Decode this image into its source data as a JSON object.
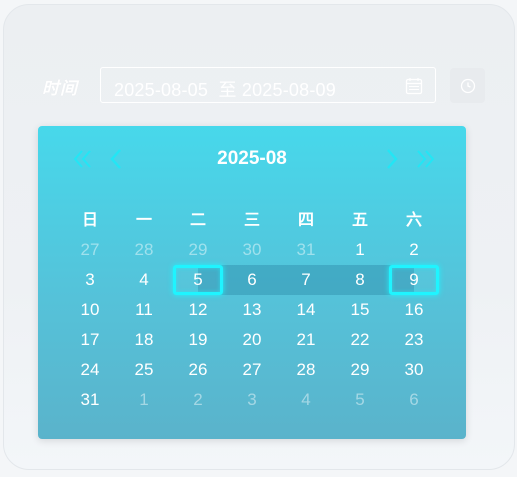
{
  "filter": {
    "label": "时间",
    "range_text": "2025-08-05  至 2025-08-09"
  },
  "icons": {
    "calendar": "calendar-icon",
    "clock": "clock-icon",
    "prev_year": "double-chevron-left-icon",
    "prev_month": "chevron-left-icon",
    "next_month": "chevron-right-icon",
    "next_year": "double-chevron-right-icon"
  },
  "colors": {
    "calendar_top": "#47d8eb",
    "calendar_bottom": "#5ab3cb",
    "selected_border": "#1ff4ff",
    "range_band": "#3b93ab"
  },
  "calendar": {
    "title": "2025-08",
    "weekdays": [
      "日",
      "一",
      "二",
      "三",
      "四",
      "五",
      "六"
    ],
    "weeks": [
      [
        {
          "d": "27",
          "m": true
        },
        {
          "d": "28",
          "m": true
        },
        {
          "d": "29",
          "m": true
        },
        {
          "d": "30",
          "m": true
        },
        {
          "d": "31",
          "m": true
        },
        {
          "d": "1"
        },
        {
          "d": "2"
        }
      ],
      [
        {
          "d": "3"
        },
        {
          "d": "4"
        },
        {
          "d": "5",
          "start": true
        },
        {
          "d": "6",
          "in": true
        },
        {
          "d": "7",
          "in": true
        },
        {
          "d": "8",
          "in": true
        },
        {
          "d": "9",
          "end": true
        }
      ],
      [
        {
          "d": "10"
        },
        {
          "d": "11"
        },
        {
          "d": "12"
        },
        {
          "d": "13"
        },
        {
          "d": "14"
        },
        {
          "d": "15"
        },
        {
          "d": "16"
        }
      ],
      [
        {
          "d": "17"
        },
        {
          "d": "18"
        },
        {
          "d": "19"
        },
        {
          "d": "20"
        },
        {
          "d": "21"
        },
        {
          "d": "22"
        },
        {
          "d": "23"
        }
      ],
      [
        {
          "d": "24"
        },
        {
          "d": "25"
        },
        {
          "d": "26"
        },
        {
          "d": "27"
        },
        {
          "d": "28"
        },
        {
          "d": "29"
        },
        {
          "d": "30"
        }
      ],
      [
        {
          "d": "31"
        },
        {
          "d": "1",
          "m": true
        },
        {
          "d": "2",
          "m": true
        },
        {
          "d": "3",
          "m": true
        },
        {
          "d": "4",
          "m": true
        },
        {
          "d": "5",
          "m": true
        },
        {
          "d": "6",
          "m": true
        }
      ]
    ]
  }
}
